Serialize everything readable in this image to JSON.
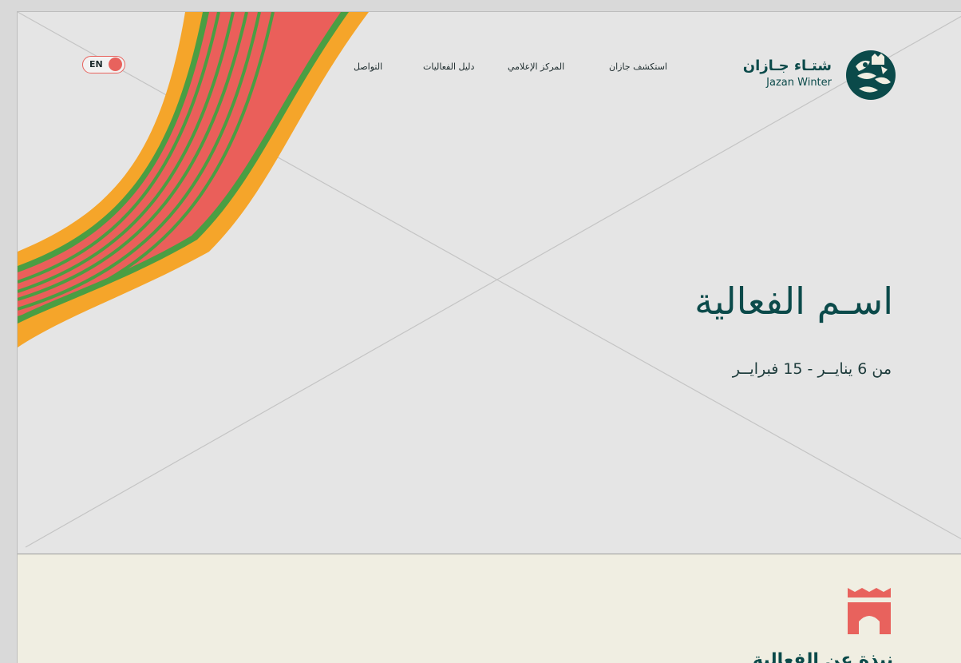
{
  "brand": {
    "name_ar": "شتـاء جـازان",
    "name_en": "Jazan Winter",
    "logo_icon": "jazan-winter-logo-icon"
  },
  "nav": {
    "items": [
      {
        "label": "استكشف جازان"
      },
      {
        "label": "المركز الإعلامي"
      },
      {
        "label": "دليل الفعاليات"
      },
      {
        "label": "التواصل"
      }
    ]
  },
  "language_toggle": {
    "label": "EN"
  },
  "hero": {
    "title": "اسـم الفعالية",
    "date": "من 6 ينايــر - 15 فبرايــر",
    "image": "image-placeholder-icon"
  },
  "about": {
    "icon": "castle-icon",
    "title": "نبذة عن الفعالية"
  },
  "colors": {
    "brand_teal": "#0b4a4a",
    "accent_coral": "#e8625d",
    "ribbon_orange": "#f5a52a",
    "ribbon_green": "#4a9e43",
    "hero_bg": "#e5e5e5",
    "about_bg": "#f0eee2"
  }
}
